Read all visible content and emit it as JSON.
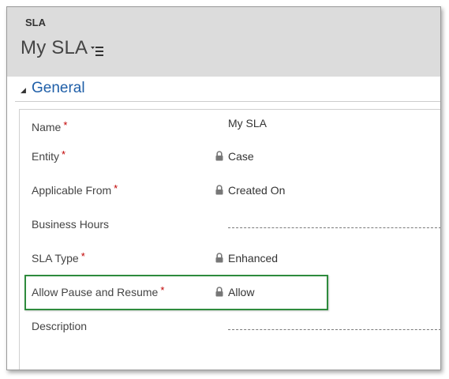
{
  "header": {
    "entity_label": "SLA",
    "record_title": "My SLA",
    "nav_icon": "list-menu-icon"
  },
  "section": {
    "title": "General",
    "arrow_icon": "collapse-arrow-icon"
  },
  "fields": {
    "name": {
      "label": "Name",
      "required": "*",
      "value": "My SLA"
    },
    "entity": {
      "label": "Entity",
      "required": "*",
      "value": "Case",
      "locked": true
    },
    "applicable_from": {
      "label": "Applicable From",
      "required": "*",
      "value": "Created On",
      "locked": true
    },
    "business_hours": {
      "label": "Business Hours",
      "value": ""
    },
    "sla_type": {
      "label": "SLA Type",
      "required": "*",
      "value": "Enhanced",
      "locked": true
    },
    "allow_pause_resume": {
      "label": "Allow Pause and Resume",
      "required": "*",
      "value": "Allow",
      "locked": true
    },
    "description": {
      "label": "Description",
      "value": ""
    }
  },
  "colors": {
    "section_title": "#1f5fa8",
    "required_marker": "#c00000",
    "highlight_border": "#2e8b3d",
    "header_bg": "#dcdcdc"
  }
}
